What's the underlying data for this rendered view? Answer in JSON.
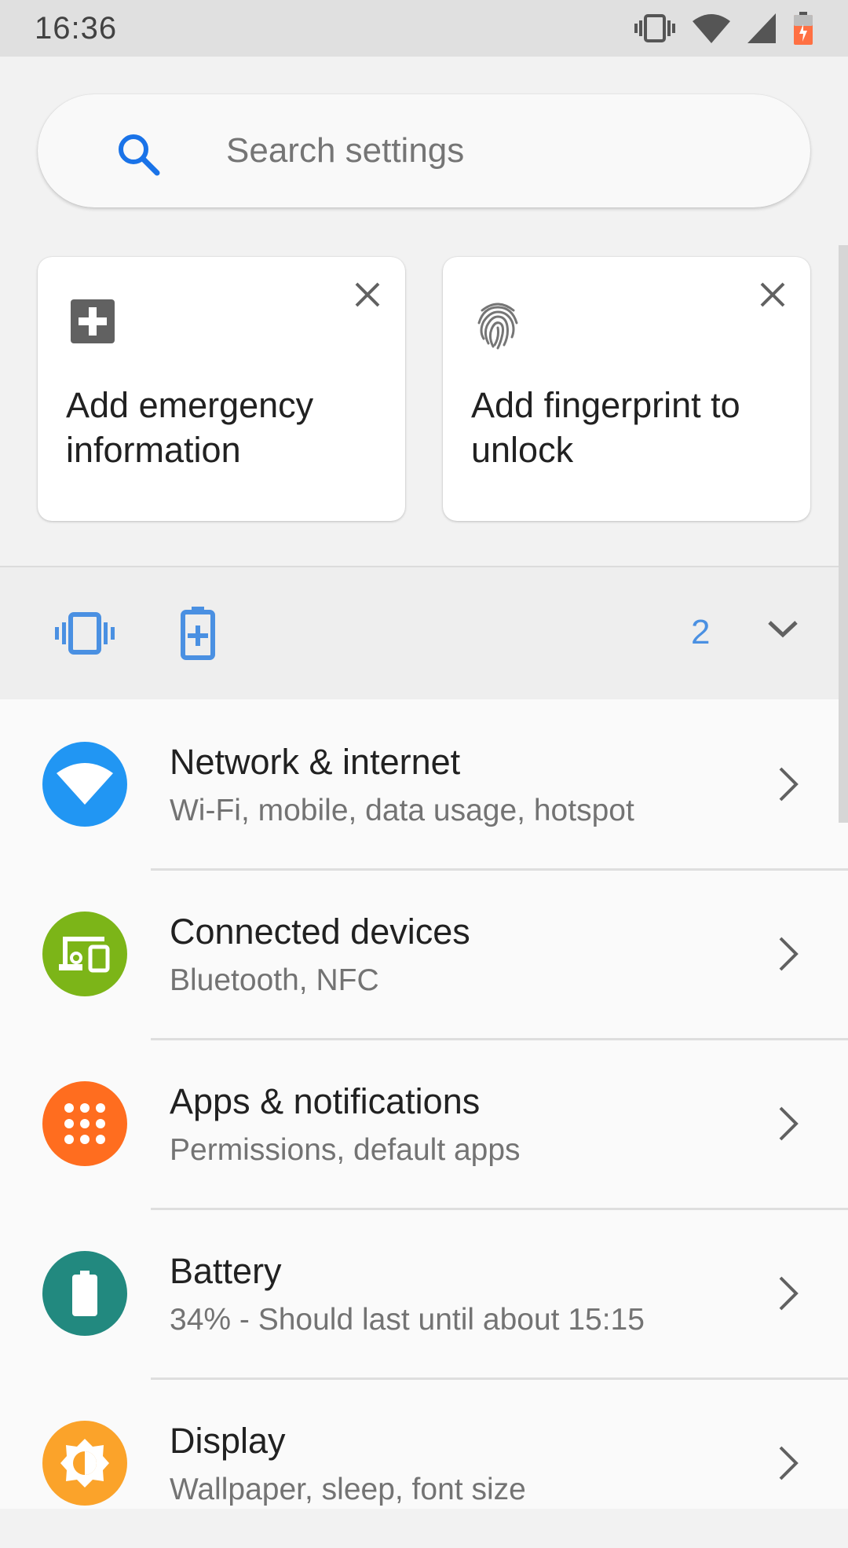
{
  "status_bar": {
    "time": "16:36",
    "icons": [
      "vibrate-icon",
      "wifi-icon",
      "signal-icon",
      "battery-charging-icon"
    ],
    "battery_color": "#ff7043"
  },
  "search": {
    "placeholder": "Search settings",
    "icon": "search-icon",
    "icon_color": "#1a73e8"
  },
  "suggestions": [
    {
      "title": "Add emergency information",
      "icon": "emergency-plus-icon"
    },
    {
      "title": "Add fingerprint to unlock",
      "icon": "fingerprint-icon"
    }
  ],
  "conditions": {
    "icons": [
      "vibrate-icon",
      "battery-saver-icon"
    ],
    "count": "2",
    "accent": "#4a90e2"
  },
  "settings_items": [
    {
      "title": "Network & internet",
      "subtitle": "Wi-Fi, mobile, data usage, hotspot",
      "icon": "wifi-icon",
      "color": "#2196f3"
    },
    {
      "title": "Connected devices",
      "subtitle": "Bluetooth, NFC",
      "icon": "devices-icon",
      "color": "#7cb518"
    },
    {
      "title": "Apps & notifications",
      "subtitle": "Permissions, default apps",
      "icon": "apps-grid-icon",
      "color": "#ff6d1f"
    },
    {
      "title": "Battery",
      "subtitle": "34% - Should last until about 15:15",
      "icon": "battery-icon",
      "color": "#22897f"
    },
    {
      "title": "Display",
      "subtitle": "Wallpaper, sleep, font size",
      "icon": "brightness-icon",
      "color": "#fba32a"
    }
  ]
}
